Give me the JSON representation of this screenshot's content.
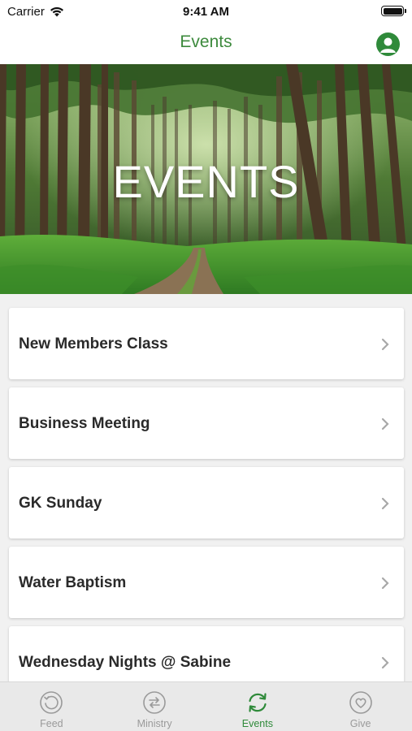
{
  "status_bar": {
    "carrier": "Carrier",
    "time": "9:41 AM"
  },
  "nav": {
    "title": "Events",
    "profile_icon": "person-circle-icon"
  },
  "hero": {
    "title": "EVENTS",
    "image": "forest-path-photo"
  },
  "events": [
    {
      "label": "New Members Class"
    },
    {
      "label": "Business Meeting"
    },
    {
      "label": "GK Sunday"
    },
    {
      "label": "Water Baptism"
    },
    {
      "label": "Wednesday Nights @ Sabine"
    }
  ],
  "tabs": [
    {
      "label": "Feed",
      "icon": "history-icon",
      "active": false
    },
    {
      "label": "Ministry",
      "icon": "swap-arrows-icon",
      "active": false
    },
    {
      "label": "Events",
      "icon": "refresh-icon",
      "active": true
    },
    {
      "label": "Give",
      "icon": "heart-icon",
      "active": false
    }
  ],
  "colors": {
    "accent": "#2f8a3a",
    "title_green": "#3d8a3d",
    "inactive": "#9a9a9a",
    "background": "#f1f1f1",
    "tab_bar": "#e9e9e9"
  }
}
